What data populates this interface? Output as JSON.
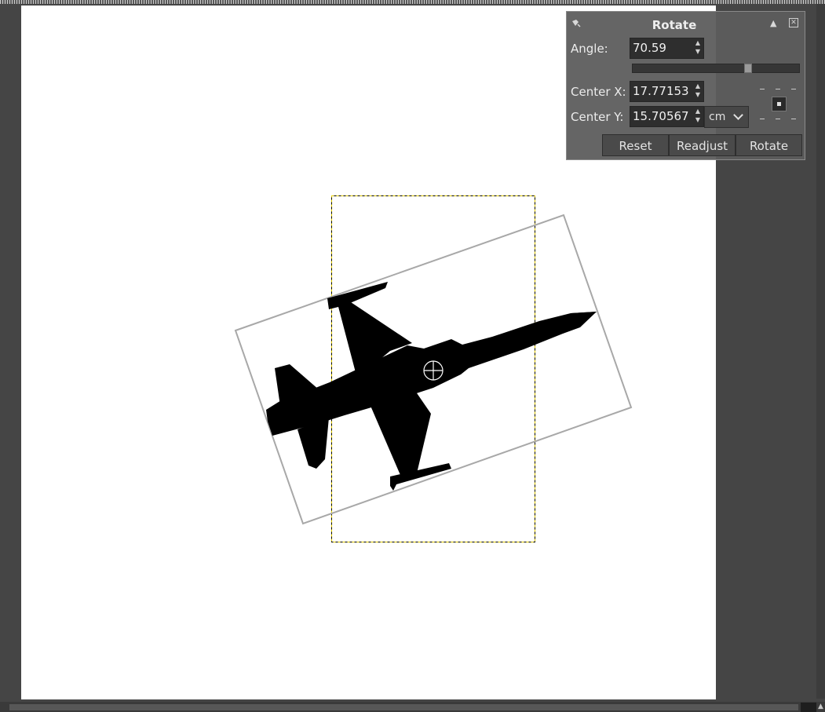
{
  "dialog": {
    "title": "Rotate",
    "angle_label": "Angle:",
    "angle_value": "70.59",
    "angle_slider_fraction": 0.7,
    "center_x_label": "Center X:",
    "center_x_value": "17.77153",
    "center_y_label": "Center Y:",
    "center_y_value": "15.70567",
    "unit": "cm",
    "buttons": {
      "reset": "Reset",
      "readjust": "Readjust",
      "rotate": "Rotate"
    }
  },
  "icons": {
    "rotate_tool": "rotate-tool-icon",
    "shade": "shade-triangle-icon",
    "close": "close-icon",
    "pivot": "pivot-center-icon",
    "crosshair": "crosshair-icon"
  },
  "colors": {
    "background": "#454545",
    "canvas": "#ffffff",
    "dialog": "#5d5d5d",
    "selection_dashes": "#e8d000",
    "transform_frame": "#a8a8a8",
    "silhouette": "#000000"
  }
}
